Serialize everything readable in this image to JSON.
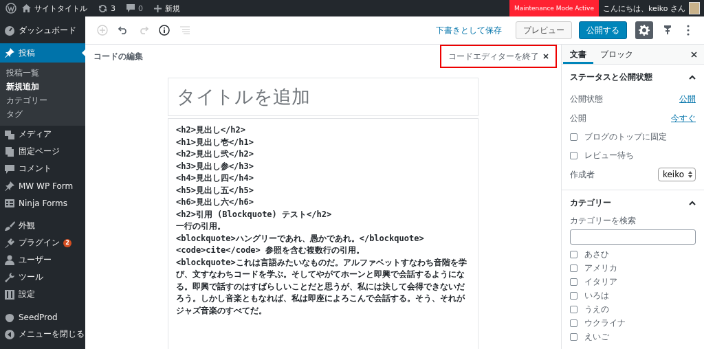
{
  "admin_bar": {
    "site_title": "サイトタイトル",
    "updates": "3",
    "comments": "0",
    "new_label": "新規",
    "maintenance": "Maintenance Mode Active",
    "greeting": "こんにちは、keiko さん"
  },
  "sidebar": {
    "groups": [
      [
        {
          "label": "ダッシュボード",
          "selected": false
        },
        {
          "label": "投稿",
          "selected": true,
          "children": [
            {
              "label": "投稿一覧",
              "selected": false
            },
            {
              "label": "新規追加",
              "selected": true
            },
            {
              "label": "カテゴリー",
              "selected": false
            },
            {
              "label": "タグ",
              "selected": false
            }
          ]
        },
        {
          "label": "メディア",
          "selected": false
        },
        {
          "label": "固定ページ",
          "selected": false
        },
        {
          "label": "コメント",
          "selected": false
        },
        {
          "label": "MW WP Form",
          "selected": false
        },
        {
          "label": "Ninja Forms",
          "selected": false
        }
      ],
      [
        {
          "label": "外観",
          "selected": false
        },
        {
          "label": "プラグイン",
          "selected": false,
          "badge": "2"
        },
        {
          "label": "ユーザー",
          "selected": false
        },
        {
          "label": "ツール",
          "selected": false
        },
        {
          "label": "設定",
          "selected": false
        }
      ],
      [
        {
          "label": "SeedProd",
          "selected": false
        },
        {
          "label": "メニューを閉じる",
          "selected": false
        }
      ]
    ]
  },
  "toolbar": {
    "save_draft": "下書きとして保存",
    "preview": "プレビュー",
    "publish": "公開する",
    "settings_active": true
  },
  "mode_bar": {
    "label": "コードの編集",
    "exit_button": "コードエディターを終了"
  },
  "editor": {
    "title_placeholder": "タイトルを追加",
    "code_lines": [
      "<h2>見出し</h2>",
      "<h1>見出し壱</h1>",
      "<h2>見出し弐</h2>",
      "<h3>見出し参</h3>",
      "<h4>見出し四</h4>",
      "<h5>見出し五</h5>",
      "<h6>見出し六</h6>",
      "<h2>引用 (Blockquote) テスト</h2>",
      "一行の引用。",
      "<blockquote>ハングリーであれ、愚かであれ。</blockquote>",
      "<code>cite</code> 参照を含む複数行の引用。",
      "<blockquote>これは言語みたいなものだ。アルファベットすなわち音階を学び、文すなわちコードを学ぶ。そしてやがてホーンと即興で会話するようになる。即興で話すのはすばらしいことだと思うが、私には決して会得できないだろう。しかし音楽ともなれば、私は即座によろこんで会話する。そう、それがジャズ音楽のすべてだ。"
    ]
  },
  "panel": {
    "tabs": [
      {
        "label": "文書",
        "selected": true
      },
      {
        "label": "ブロック",
        "selected": false
      }
    ],
    "status": {
      "title": "ステータスと公開状態",
      "expanded": true,
      "rows": [
        {
          "label": "公開状態",
          "value": "公開"
        },
        {
          "label": "公開",
          "value": "今すぐ"
        }
      ],
      "checkboxes": [
        {
          "label": "ブログのトップに固定",
          "checked": false
        },
        {
          "label": "レビュー待ち",
          "checked": false
        }
      ],
      "author": {
        "label": "作成者",
        "value": "keiko"
      }
    },
    "categories": {
      "title": "カテゴリー",
      "expanded": true,
      "search_label": "カテゴリーを検索",
      "items": [
        {
          "label": "あさひ",
          "checked": false
        },
        {
          "label": "アメリカ",
          "checked": false
        },
        {
          "label": "イタリア",
          "checked": false
        },
        {
          "label": "いろは",
          "checked": false
        },
        {
          "label": "うえの",
          "checked": false
        },
        {
          "label": "ウクライナ",
          "checked": false
        },
        {
          "label": "えいご",
          "checked": false
        }
      ]
    }
  }
}
